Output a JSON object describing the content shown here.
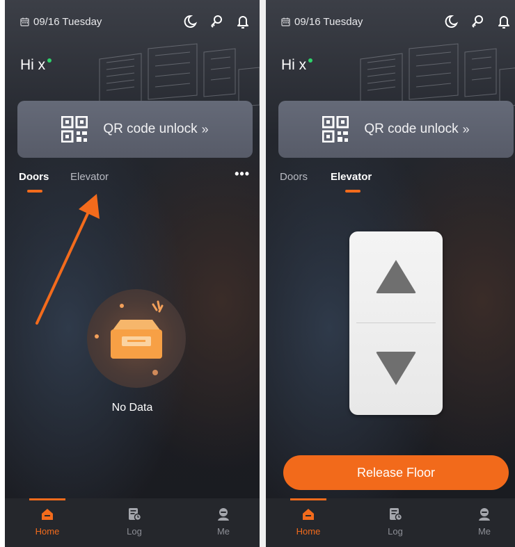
{
  "colors": {
    "accent": "#f36b1c",
    "online": "#2ed36b",
    "card": "#5e6270"
  },
  "screens": [
    {
      "date": "09/16 Tuesday",
      "greeting": "Hi x",
      "qr_label": "QR code unlock",
      "qr_chevron": "»",
      "tabs": [
        {
          "label": "Doors",
          "active": true
        },
        {
          "label": "Elevator",
          "active": false
        }
      ],
      "more": "•••",
      "empty_text": "No Data",
      "nav": [
        {
          "label": "Home",
          "icon": "home-icon",
          "active": true
        },
        {
          "label": "Log",
          "icon": "log-icon"
        },
        {
          "label": "Me",
          "icon": "user-icon"
        }
      ]
    },
    {
      "date": "09/16 Tuesday",
      "greeting": "Hi x",
      "qr_label": "QR code unlock",
      "qr_chevron": "»",
      "tabs": [
        {
          "label": "Doors",
          "active": false
        },
        {
          "label": "Elevator",
          "active": true
        }
      ],
      "release_label": "Release Floor",
      "nav": [
        {
          "label": "Home",
          "icon": "home-icon",
          "active": true
        },
        {
          "label": "Log",
          "icon": "log-icon"
        },
        {
          "label": "Me",
          "icon": "user-icon"
        }
      ]
    }
  ]
}
